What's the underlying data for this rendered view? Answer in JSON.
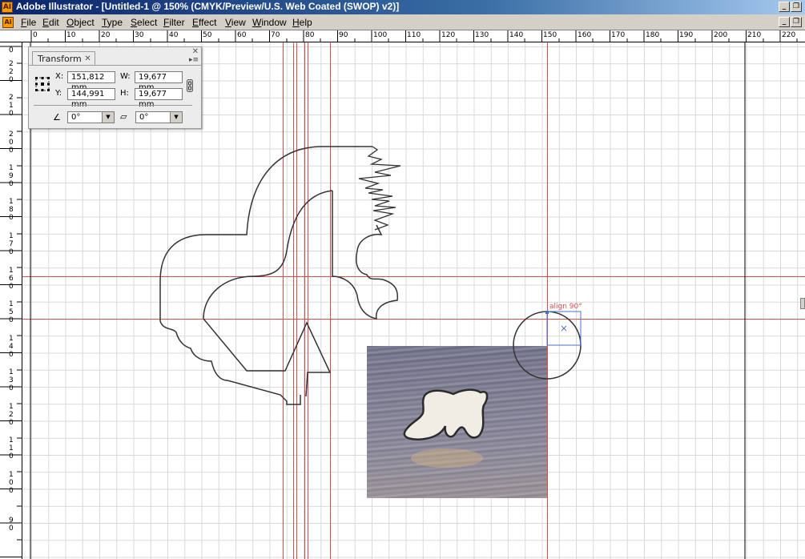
{
  "window": {
    "app_icon": "AI",
    "title": "Adobe Illustrator - [Untitled-1 @ 150% (CMYK/Preview/U.S. Web Coated (SWOP) v2)]",
    "controls": [
      "minimize-icon",
      "restore-icon"
    ]
  },
  "menubar": {
    "items": [
      "File",
      "Edit",
      "Object",
      "Type",
      "Select",
      "Filter",
      "Effect",
      "View",
      "Window",
      "Help"
    ]
  },
  "rulers": {
    "horizontal_labels": [
      "0",
      "10",
      "20",
      "30",
      "40",
      "50",
      "60",
      "70",
      "80",
      "90",
      "100",
      "110",
      "120",
      "130",
      "140",
      "150",
      "160",
      "170",
      "180",
      "190",
      "200",
      "210",
      "220"
    ],
    "vertical_labels": [
      "0",
      "2\n2\n0",
      "2\n1\n0",
      "2\n0\n0",
      "1\n9\n0",
      "1\n8\n0",
      "1\n7\n0",
      "1\n6\n0",
      "1\n5\n0",
      "1\n4\n0",
      "1\n3\n0",
      "1\n2\n0",
      "1\n1\n0",
      "1\n0\n0",
      "9\n0"
    ]
  },
  "transform_panel": {
    "tab_label": "Transform",
    "x_label": "X:",
    "x_value": "151,812 mm",
    "y_label": "Y:",
    "y_value": "144,991 mm",
    "w_label": "W:",
    "w_value": "19,677 mm",
    "h_label": "H:",
    "h_value": "19,677 mm",
    "rotate_value": "0°",
    "shear_value": "0°"
  },
  "canvas": {
    "smart_guide_label": "align 90°",
    "guide_color": "#d94c4c",
    "selection_color": "#4a6fd0"
  }
}
